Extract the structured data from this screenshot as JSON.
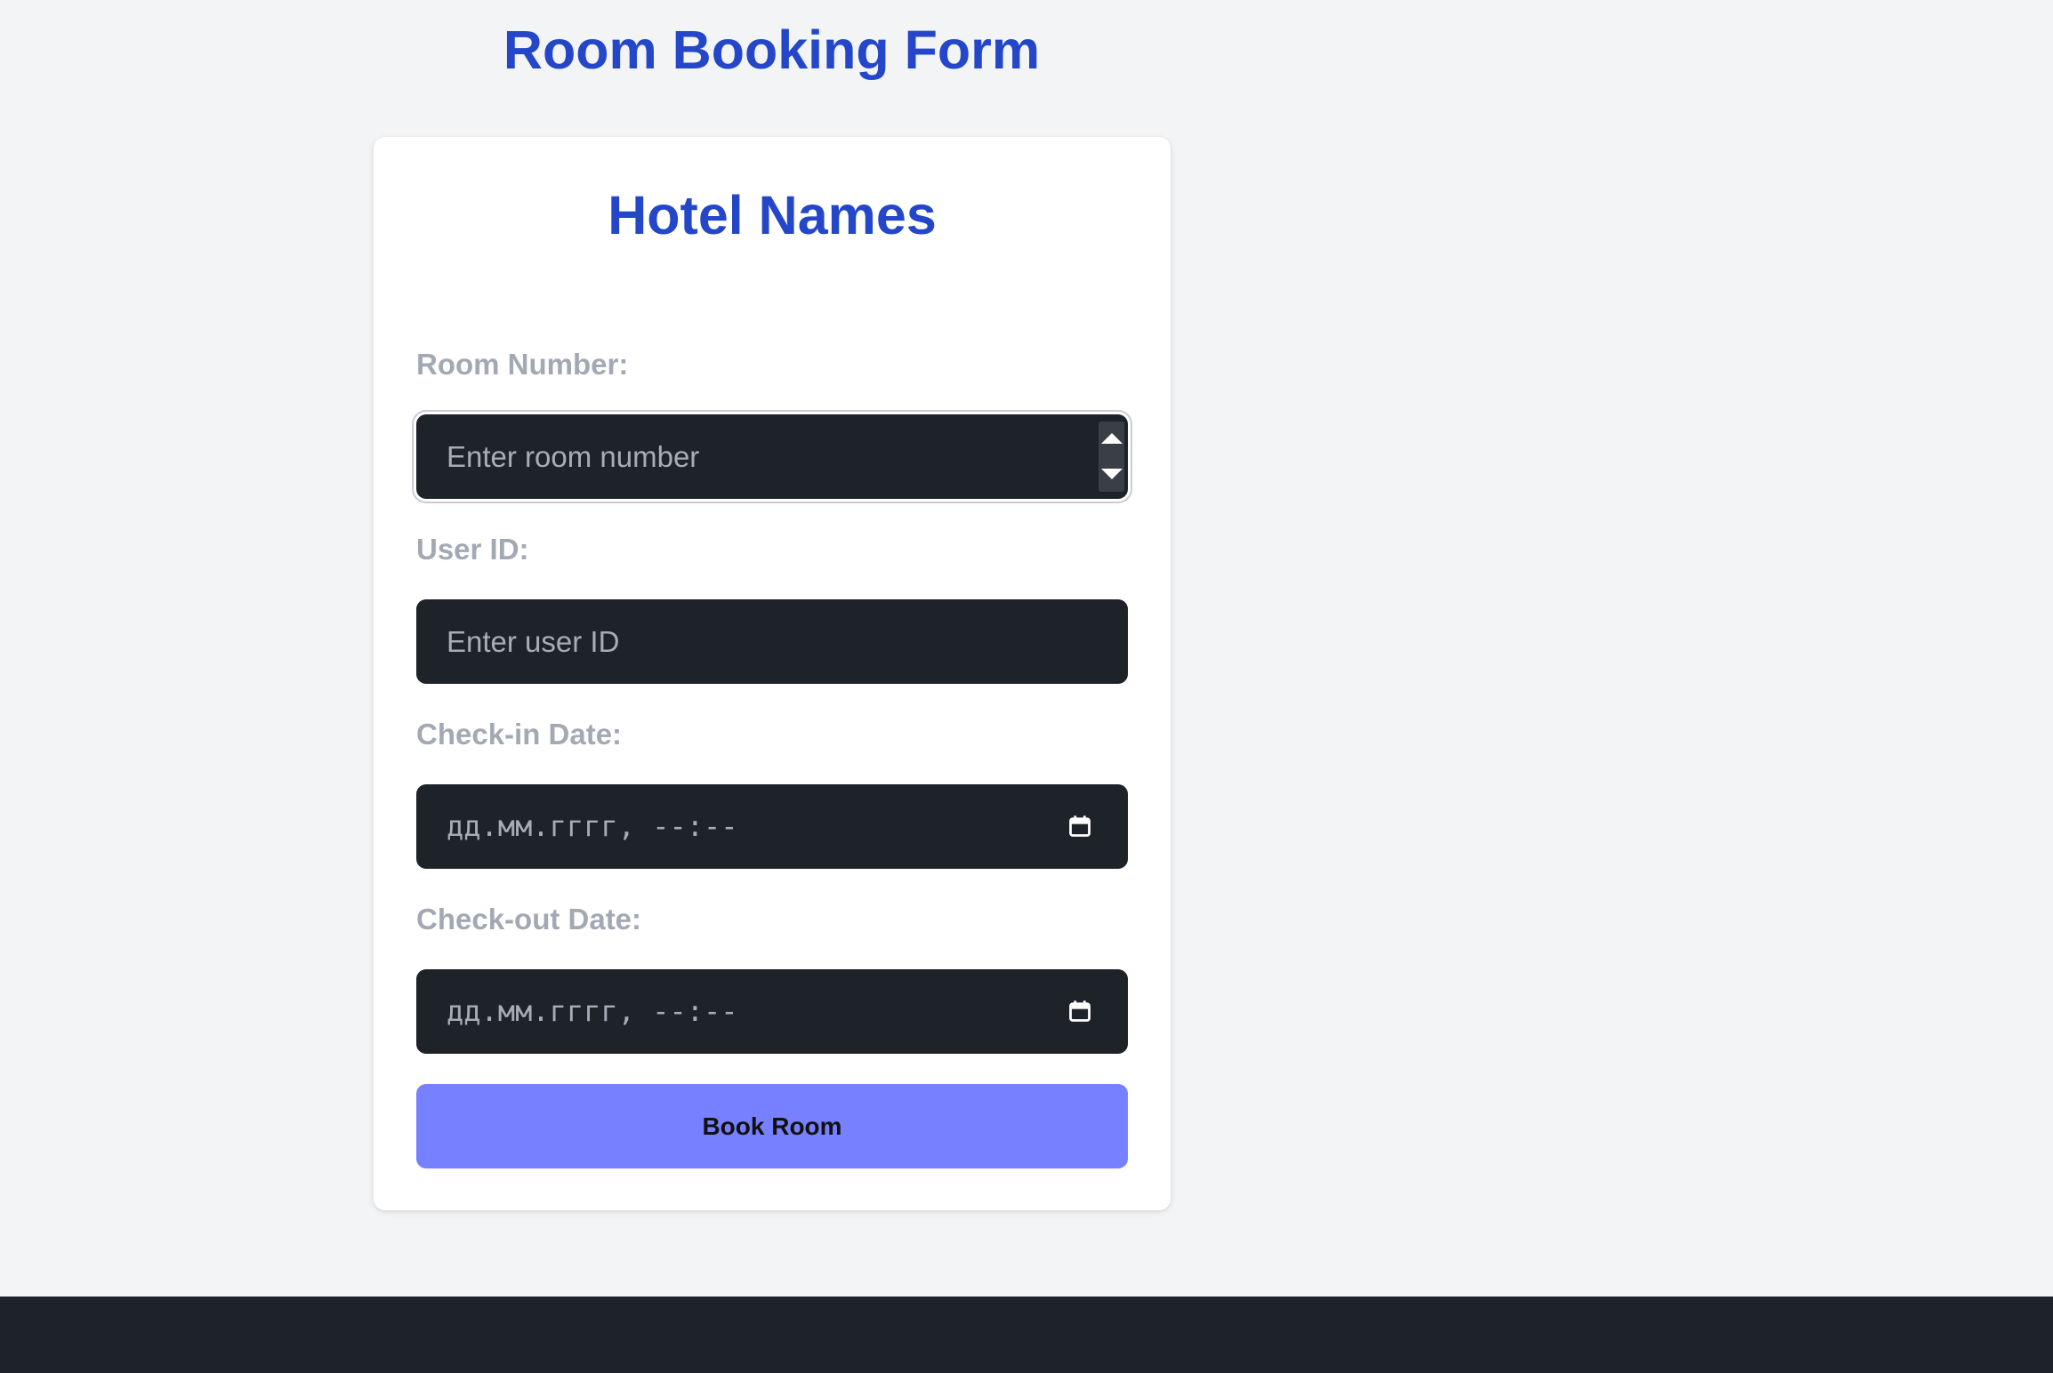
{
  "page": {
    "title": "Room Booking Form"
  },
  "card": {
    "title": "Hotel Names"
  },
  "form": {
    "room_number": {
      "label": "Room Number:",
      "placeholder": "Enter room number"
    },
    "user_id": {
      "label": "User ID:",
      "placeholder": "Enter user ID"
    },
    "check_in": {
      "label": "Check-in Date:",
      "placeholder": "дд.мм.гггг, --:--"
    },
    "check_out": {
      "label": "Check-out Date:",
      "placeholder": "дд.мм.гггг, --:--"
    },
    "submit_label": "Book Room"
  },
  "icons": {
    "spinner_up": "triangle-up",
    "spinner_down": "triangle-down",
    "date_picker": "calendar"
  },
  "colors": {
    "heading": "#2447c9",
    "page_background": "#f3f4f6",
    "card_background": "#ffffff",
    "label": "#a3a9b4",
    "input_background": "#1e2229",
    "placeholder": "#a7adb7",
    "button": "#7780ff",
    "button_text": "#111111",
    "footer": "#1e2229"
  }
}
